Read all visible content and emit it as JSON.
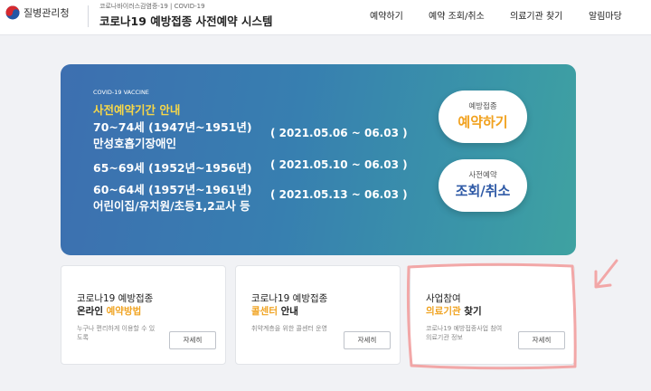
{
  "header": {
    "org_name": "질병관리청",
    "subtitle": "코로나바이러스감염증-19 | COVID-19",
    "title": "코로나19 예방접종 사전예약 시스템",
    "nav": [
      "예약하기",
      "예약 조회/취소",
      "의료기관 찾기",
      "알림마당"
    ]
  },
  "banner": {
    "tag": "COVID-19 VACCINE",
    "heading": "사전예약기간 안내",
    "groups": [
      {
        "line1": "70~74세 (1947년~1951년)",
        "line2": "만성호흡기장애인",
        "period": "( 2021.05.06 ~ 06.03 )"
      },
      {
        "line1": "65~69세 (1952년~1956년)",
        "line2": "",
        "period": "( 2021.05.10 ~ 06.03 )"
      },
      {
        "line1": "60~64세 (1957년~1961년)",
        "line2": "어린이집/유치원/초등1,2교사 등",
        "period": "( 2021.05.13 ~ 06.03 )"
      }
    ],
    "btn_reserve": {
      "small": "예방접종",
      "big": "예약하기"
    },
    "btn_lookup": {
      "small": "사전예약",
      "big": "조회/취소"
    }
  },
  "cards": [
    {
      "line1": "코로나19 예방접종",
      "line2_plain": "온라인 ",
      "line2_highlight": "예약방법",
      "desc": "누구나 편리하게 이용할 수 있도록",
      "button": "자세히"
    },
    {
      "line1": "코로나19 예방접종",
      "line2_highlight": "콜센터",
      "line2_plain": " 안내",
      "desc": "취약계층을 위한 콜센터 운영",
      "button": "자세히"
    },
    {
      "line1": "사업참여",
      "line2_highlight": "의료기관",
      "line2_plain": " 찾기",
      "desc": "코로나19 예방접종사업 참여의료기관 정보",
      "button": "자세히"
    }
  ],
  "colors": {
    "banner_start": "#3d6fb0",
    "banner_end": "#3fa2a1",
    "heading_yellow": "#f7d748",
    "pill_text_orange": "#f1a11e",
    "pill_text_blue": "#2f5aa6",
    "highlight": "#f0a321",
    "annotation_pink": "#f2a7a7"
  }
}
